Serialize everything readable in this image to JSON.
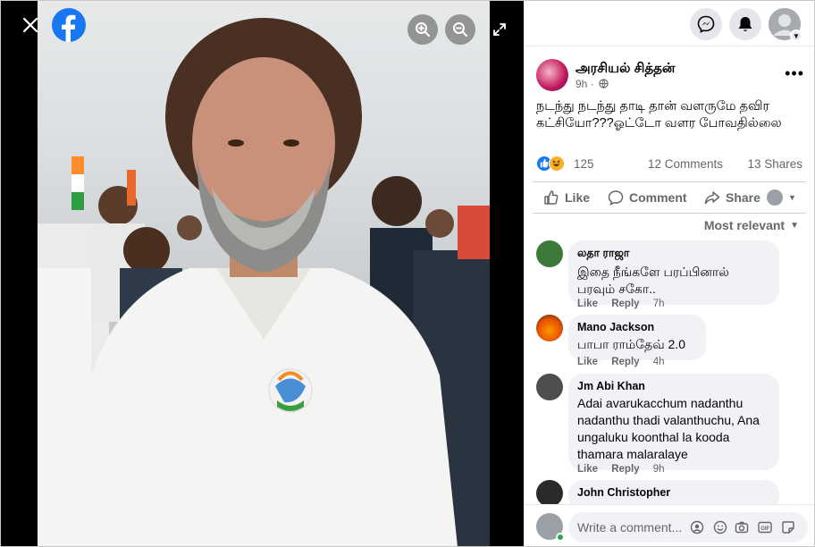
{
  "viewer": {
    "close_icon": "close-icon",
    "logo_icon": "facebook-logo-icon",
    "zoom_in_icon": "zoom-in-icon",
    "zoom_out_icon": "zoom-out-icon",
    "fullscreen_icon": "fullscreen-icon"
  },
  "topbar": {
    "messenger_icon": "messenger-icon",
    "notifications_icon": "bell-icon",
    "account_icon": "avatar"
  },
  "post": {
    "author": "அரசியல் சித்தன்",
    "time": "9h ·",
    "text": "நடந்து நடந்து தாடி தான் வளருமே தவிர கட்சியோ???ஓட்டோ வளர போவதில்லை",
    "reaction_count": "125",
    "comments": "12 Comments",
    "shares": "13 Shares"
  },
  "actions": {
    "like": "Like",
    "comment": "Comment",
    "share": "Share"
  },
  "sort": {
    "label": "Most relevant"
  },
  "comments": [
    {
      "name": "லதா ராஜா",
      "text": "இதை நீங்களே பரப்பினால் பரவும் சகோ..",
      "like": "Like",
      "reply": "Reply",
      "time": "7h"
    },
    {
      "name": "Mano Jackson",
      "text": "பாபா ராம்தேவ் 2.0",
      "like": "Like",
      "reply": "Reply",
      "time": "4h"
    },
    {
      "name": "Jm Abi Khan",
      "text": "Adai avarukacchum nadanthu nadanthu thadi valanthuchu, Ana ungaluku koonthal la kooda thamara malaralaye",
      "like": "Like",
      "reply": "Reply",
      "time": "9h"
    },
    {
      "name": "John Christopher",
      "text": ""
    }
  ],
  "composer": {
    "placeholder": "Write a comment..."
  },
  "colors": {
    "accent": "#1877f2",
    "muted": "#65676b",
    "bubble": "#f0f2f5"
  }
}
